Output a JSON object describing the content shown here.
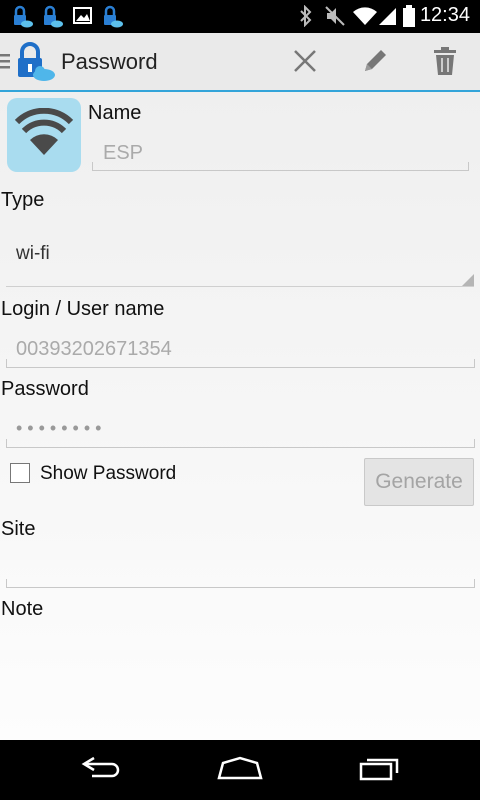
{
  "status_bar": {
    "time": "12:34",
    "left_icons": [
      "lock-cloud-icon",
      "lock-cloud-icon",
      "image-icon",
      "lock-cloud-icon"
    ],
    "right_icons": [
      "bluetooth-icon",
      "mute-icon",
      "wifi-signal-icon",
      "cell-signal-icon",
      "battery-icon"
    ]
  },
  "action_bar": {
    "title": "Password",
    "actions": [
      "close-icon",
      "edit-pencil-icon",
      "trash-icon"
    ],
    "accent_color": "#33a4d9"
  },
  "form": {
    "name_label": "Name",
    "name_value": "ESP",
    "type_label": "Type",
    "type_value": "wi-fi",
    "login_label": "Login / User name",
    "login_value": "00393202671354",
    "password_label": "Password",
    "password_value": "• • • • • • • •",
    "show_password_label": "Show Password",
    "show_password_checked": false,
    "generate_label": "Generate",
    "site_label": "Site",
    "site_value": "",
    "note_label": "Note"
  },
  "nav_bar": {
    "buttons": [
      "back-icon",
      "home-icon",
      "recent-apps-icon"
    ]
  }
}
